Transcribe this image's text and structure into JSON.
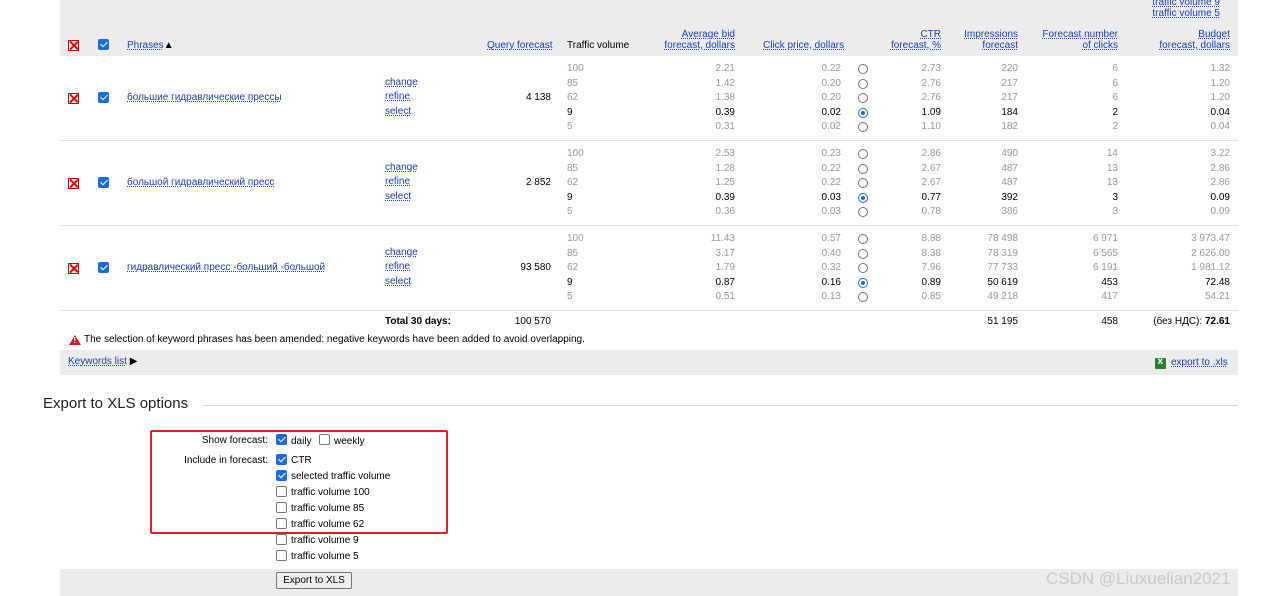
{
  "header": {
    "phrases": "Phrases",
    "sort_arrow": "▲",
    "query_forecast": "Query forecast",
    "traffic_volume": "Traffic volume",
    "avg_bid_1": "Average bid",
    "avg_bid_2": "forecast, dollars",
    "click_price": "Click price, dollars",
    "ctr_1": "CTR",
    "ctr_2": "forecast, %",
    "impr_1": "Impressions",
    "impr_2": "forecast",
    "clicks_1": "Forecast number",
    "clicks_2": "of clicks",
    "budget_1": "Budget",
    "budget_2": "forecast, dollars",
    "budget_tv9": "traffic volume 9",
    "budget_tv5": "traffic volume 5"
  },
  "actions": {
    "change": "change",
    "refine": "refine",
    "select": "select"
  },
  "rows": [
    {
      "phrase": "большие гидравлические прессы",
      "query": "4 138",
      "levels": [
        {
          "tv": "100",
          "bid": "2.21",
          "click": "0.22",
          "ctr": "2.73",
          "impr": "220",
          "clicks": "6",
          "budget": "1.32"
        },
        {
          "tv": "85",
          "bid": "1.42",
          "click": "0.20",
          "ctr": "2.76",
          "impr": "217",
          "clicks": "6",
          "budget": "1.20"
        },
        {
          "tv": "62",
          "bid": "1.38",
          "click": "0.20",
          "ctr": "2.76",
          "impr": "217",
          "clicks": "6",
          "budget": "1.20"
        },
        {
          "tv": "9",
          "bid": "0.39",
          "click": "0.02",
          "ctr": "1.09",
          "impr": "184",
          "clicks": "2",
          "budget": "0.04"
        },
        {
          "tv": "5",
          "bid": "0.31",
          "click": "0.02",
          "ctr": "1.10",
          "impr": "182",
          "clicks": "2",
          "budget": "0.04"
        }
      ]
    },
    {
      "phrase": "большой гидравлический пресс",
      "query": "2 852",
      "levels": [
        {
          "tv": "100",
          "bid": "2.53",
          "click": "0.23",
          "ctr": "2.86",
          "impr": "490",
          "clicks": "14",
          "budget": "3.22"
        },
        {
          "tv": "85",
          "bid": "1.28",
          "click": "0.22",
          "ctr": "2.67",
          "impr": "487",
          "clicks": "13",
          "budget": "2.86"
        },
        {
          "tv": "62",
          "bid": "1.25",
          "click": "0.22",
          "ctr": "2.67",
          "impr": "487",
          "clicks": "13",
          "budget": "2.86"
        },
        {
          "tv": "9",
          "bid": "0.39",
          "click": "0.03",
          "ctr": "0.77",
          "impr": "392",
          "clicks": "3",
          "budget": "0.09"
        },
        {
          "tv": "5",
          "bid": "0.36",
          "click": "0.03",
          "ctr": "0.78",
          "impr": "386",
          "clicks": "3",
          "budget": "0.09"
        }
      ]
    },
    {
      "phrase": "гидравлический пресс -больший -большой",
      "query": "93 580",
      "levels": [
        {
          "tv": "100",
          "bid": "11.43",
          "click": "0.57",
          "ctr": "8.88",
          "impr": "78 498",
          "clicks": "6 971",
          "budget": "3 973.47"
        },
        {
          "tv": "85",
          "bid": "3.17",
          "click": "0.40",
          "ctr": "8.38",
          "impr": "78 319",
          "clicks": "6 565",
          "budget": "2 626.00"
        },
        {
          "tv": "62",
          "bid": "1.79",
          "click": "0.32",
          "ctr": "7.96",
          "impr": "77 733",
          "clicks": "6 191",
          "budget": "1 981.12"
        },
        {
          "tv": "9",
          "bid": "0.87",
          "click": "0.16",
          "ctr": "0.89",
          "impr": "50 619",
          "clicks": "453",
          "budget": "72.48"
        },
        {
          "tv": "5",
          "bid": "0.51",
          "click": "0.13",
          "ctr": "0.85",
          "impr": "49 218",
          "clicks": "417",
          "budget": "54.21"
        }
      ]
    }
  ],
  "selected_level_index": 3,
  "totals": {
    "label": "Total 30 days:",
    "query": "100 570",
    "impr": "51 195",
    "clicks": "458",
    "budget_prefix": "(без НДС):",
    "budget": "72.61"
  },
  "warning": "The selection of keyword phrases has been amended: negative keywords have been added to avoid overlapping.",
  "keywords_list": "Keywords list",
  "keywords_list_arrow": "▶",
  "export_link": "export to .xls",
  "export_options": {
    "title": "Export to XLS options",
    "show_forecast_label": "Show forecast:",
    "daily": "daily",
    "weekly": "weekly",
    "include_label": "Include in forecast:",
    "include_items": [
      {
        "label": "CTR",
        "checked": true
      },
      {
        "label": "selected traffic volume",
        "checked": true
      },
      {
        "label": "traffic volume 100",
        "checked": false
      },
      {
        "label": "traffic volume 85",
        "checked": false
      },
      {
        "label": "traffic volume 62",
        "checked": false
      },
      {
        "label": "traffic volume 9",
        "checked": false
      },
      {
        "label": "traffic volume 5",
        "checked": false
      }
    ],
    "button": "Export to XLS"
  },
  "watermark": "CSDN @Liuxuelian2021",
  "colors": {
    "link": "#1a3dc1",
    "highlight_box": "#e02020",
    "checkbox": "#1a6de0"
  }
}
